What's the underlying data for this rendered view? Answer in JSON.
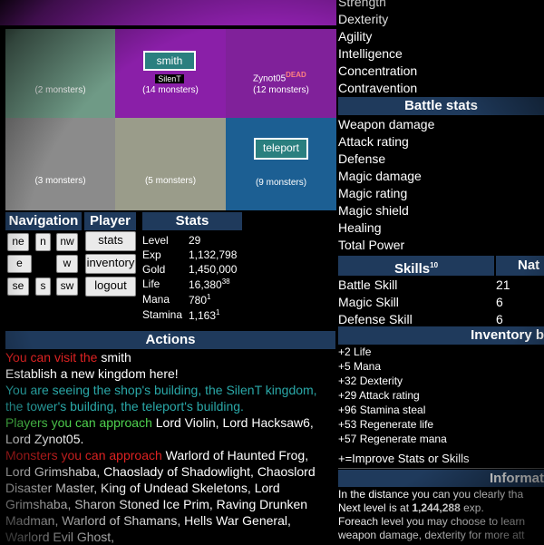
{
  "colors": {
    "cell_teal_green": "#6f9a86",
    "cell_purple1": "#8a1fa8",
    "cell_purple2": "#80219a",
    "cell_gray": "#8b8b8b",
    "cell_sage": "#9a9c8a",
    "cell_blue": "#1c5f93",
    "header_bg": "#1f3a5c"
  },
  "map": {
    "cells": [
      {
        "count": "(2 monsters)"
      },
      {
        "count": "(14 monsters)",
        "building": "smith",
        "player": "SilenT"
      },
      {
        "count": "(12 monsters)",
        "player": "Zynot05",
        "player_status": "DEAD"
      },
      {
        "count": "(3 monsters)"
      },
      {
        "count": "(5 monsters)"
      },
      {
        "count": "(9 monsters)",
        "building": "teleport"
      }
    ]
  },
  "nav": {
    "title": "Navigation",
    "buttons": [
      "ne",
      "n",
      "nw",
      "e",
      "w",
      "se",
      "s",
      "sw"
    ]
  },
  "player": {
    "title": "Player",
    "buttons": [
      "stats",
      "inventory",
      "logout"
    ]
  },
  "stats": {
    "title": "Stats",
    "rows": [
      {
        "label": "Level",
        "value": "29"
      },
      {
        "label": "Exp",
        "value": "1,132,798"
      },
      {
        "label": "Gold",
        "value": "1,450,000"
      },
      {
        "label": "Life",
        "value": "16,380",
        "sup": "38"
      },
      {
        "label": "Mana",
        "value": "780",
        "sup": "1"
      },
      {
        "label": "Stamina",
        "value": "1,163",
        "sup": "1"
      }
    ]
  },
  "actions": {
    "title": "Actions",
    "visit_prefix": "You can visit the ",
    "visit_target": "smith",
    "kingdom": "Establish a new kingdom here!",
    "seeing": "You are seeing the shop's building, the SilenT kingdom, the tower's building, the teleport's building.",
    "players_prefix": "Players you can approach ",
    "players_list": "Lord Violin, Lord Hacksaw6, Lord Zynot05.",
    "monsters_prefix": "Monsters you can approach ",
    "monsters_list": "Warlord of Haunted Frog, Lord Grimshaba, Chaoslady of Shadowlight, Chaoslord Disaster Master, King of Undead Skeletons, Lord Grimshaba, Sharon Stoned Ice Prim, Raving Drunken Madman, Warlord of Shamans, Hells War General, Warlord Evil Ghost,"
  },
  "attributes": [
    "Strength",
    "Dexterity",
    "Agility",
    "Intelligence",
    "Concentration",
    "Contravention"
  ],
  "battle": {
    "title": "Battle stats",
    "items": [
      "Weapon damage",
      "Attack rating",
      "Defense",
      "Magic damage",
      "Magic rating",
      "Magic shield",
      "Healing",
      "Total Power"
    ]
  },
  "skills": {
    "title": "Skills",
    "title_sup": "10",
    "col2": "Nat",
    "rows": [
      {
        "name": "Battle Skill",
        "value": "21"
      },
      {
        "name": "Magic Skill",
        "value": "6"
      },
      {
        "name": "Defense Skill",
        "value": "6"
      }
    ]
  },
  "inventory": {
    "title": "Inventory b",
    "items": [
      "+2 Life",
      "+5 Mana",
      "+32 Dexterity",
      "+29 Attack rating",
      "+96 Stamina steal",
      "+53 Regenerate life",
      "+57 Regenerate mana"
    ],
    "improve": "+=Improve Stats or Skills"
  },
  "info": {
    "title": "Informat",
    "line1": "In the distance you can you clearly tha",
    "line2_prefix": "Next level is at ",
    "line2_value": "1,244,288",
    "line2_suffix": " exp.",
    "line3": "Foreach level you may choose to learn",
    "line4": "weapon damage, dexterity for more att"
  }
}
